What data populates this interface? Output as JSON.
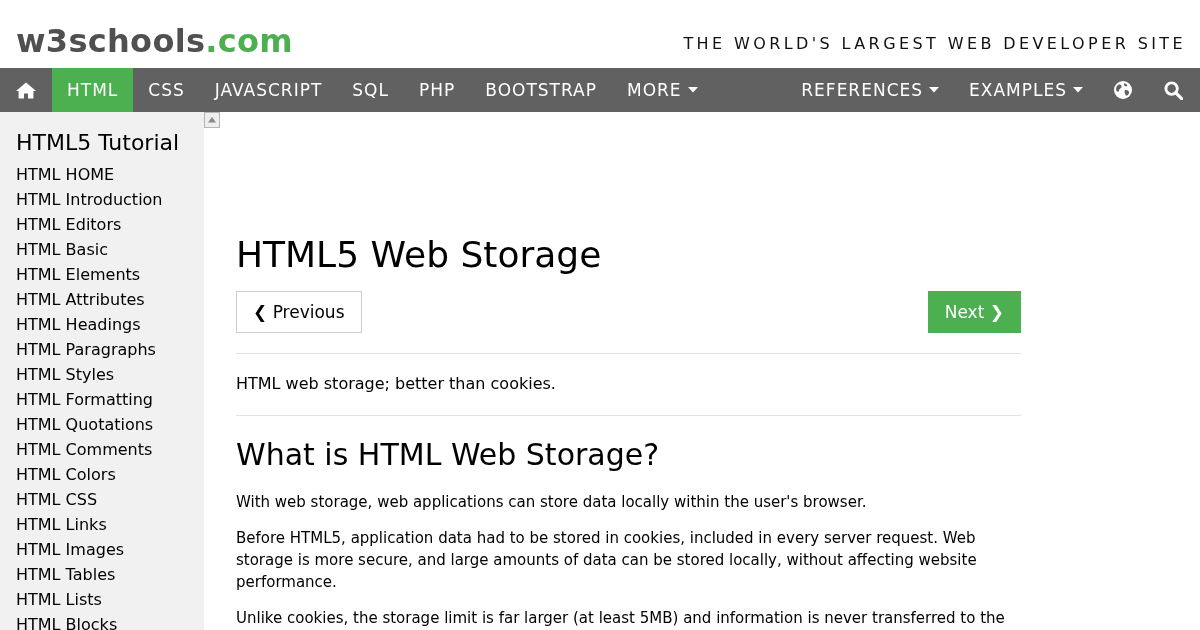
{
  "header": {
    "logo": {
      "name": "w3schools",
      "suffix": ".com"
    },
    "tagline": "THE WORLD'S LARGEST WEB DEVELOPER SITE"
  },
  "navbar": {
    "left": [
      {
        "kind": "home",
        "selected": false
      },
      {
        "kind": "link",
        "label": "HTML",
        "selected": true
      },
      {
        "kind": "link",
        "label": "CSS",
        "selected": false
      },
      {
        "kind": "link",
        "label": "JAVASCRIPT",
        "selected": false
      },
      {
        "kind": "link",
        "label": "SQL",
        "selected": false
      },
      {
        "kind": "link",
        "label": "PHP",
        "selected": false
      },
      {
        "kind": "link",
        "label": "BOOTSTRAP",
        "selected": false
      },
      {
        "kind": "menu",
        "label": "MORE",
        "selected": false
      }
    ],
    "right": [
      {
        "kind": "menu",
        "label": "REFERENCES",
        "selected": false
      },
      {
        "kind": "menu",
        "label": "EXAMPLES",
        "selected": false
      },
      {
        "kind": "globe",
        "selected": false
      },
      {
        "kind": "search",
        "selected": false
      }
    ]
  },
  "sidebar": {
    "title": "HTML5 Tutorial",
    "items": [
      {
        "label": "HTML HOME",
        "selected": false
      },
      {
        "label": "HTML Introduction",
        "selected": false
      },
      {
        "label": "HTML Editors",
        "selected": false
      },
      {
        "label": "HTML Basic",
        "selected": false
      },
      {
        "label": "HTML Elements",
        "selected": false
      },
      {
        "label": "HTML Attributes",
        "selected": false
      },
      {
        "label": "HTML Headings",
        "selected": false
      },
      {
        "label": "HTML Paragraphs",
        "selected": false
      },
      {
        "label": "HTML Styles",
        "selected": false
      },
      {
        "label": "HTML Formatting",
        "selected": false
      },
      {
        "label": "HTML Quotations",
        "selected": false
      },
      {
        "label": "HTML Comments",
        "selected": false
      },
      {
        "label": "HTML Colors",
        "selected": false
      },
      {
        "label": "HTML CSS",
        "selected": false
      },
      {
        "label": "HTML Links",
        "selected": false
      },
      {
        "label": "HTML Images",
        "selected": false
      },
      {
        "label": "HTML Tables",
        "selected": false
      },
      {
        "label": "HTML Lists",
        "selected": false
      },
      {
        "label": "HTML Blocks",
        "selected": false
      }
    ]
  },
  "main": {
    "title": "HTML5 Web Storage",
    "pager": [
      {
        "kind": "previous",
        "label": "❮ Previous"
      },
      {
        "kind": "next",
        "label": "Next ❯"
      }
    ],
    "intro": "HTML web storage; better than cookies.",
    "section_title": "What is HTML Web Storage?",
    "paragraphs": [
      "With web storage, web applications can store data locally within the user's browser.",
      "Before HTML5, application data had to be stored in cookies, included in every server request. Web storage is more secure, and large amounts of data can be stored locally, without affecting website performance.",
      "Unlike cookies, the storage limit is far larger (at least 5MB) and information is never transferred to the"
    ]
  }
}
